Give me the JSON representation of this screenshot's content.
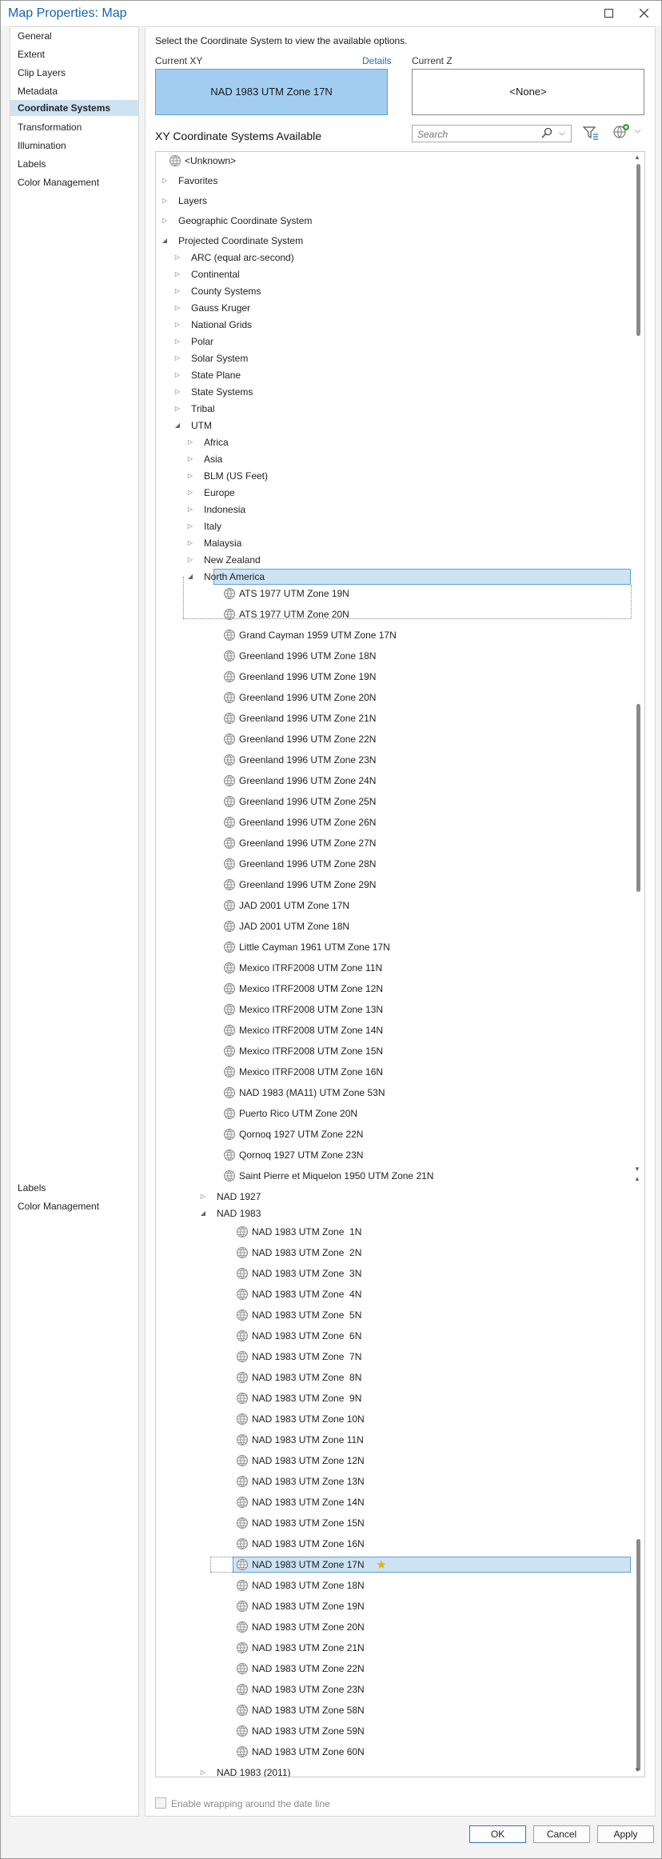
{
  "window": {
    "title": "Map Properties: Map"
  },
  "sidebar": {
    "items": [
      {
        "label": "General"
      },
      {
        "label": "Extent"
      },
      {
        "label": "Clip Layers"
      },
      {
        "label": "Metadata"
      },
      {
        "label": "Coordinate Systems",
        "selected": true
      },
      {
        "label": "Transformation"
      },
      {
        "label": "Illumination"
      },
      {
        "label": "Labels"
      },
      {
        "label": "Color Management"
      }
    ],
    "extra_items": [
      {
        "label": "Labels"
      },
      {
        "label": "Color Management"
      }
    ]
  },
  "panel": {
    "instruction": "Select the Coordinate System to view the available options.",
    "current_xy_label": "Current XY",
    "details_link": "Details",
    "current_xy_value": "NAD 1983 UTM Zone 17N",
    "current_z_label": "Current Z",
    "current_z_value": "<None>",
    "section_title": "XY Coordinate Systems Available",
    "search_placeholder": "Search",
    "wrap_label": "Enable wrapping around the date line"
  },
  "tree": {
    "rows": [
      {
        "label": "<Unknown>",
        "level": 0,
        "icon": "globe-icon"
      },
      {
        "label": "Favorites",
        "level": 0,
        "toggle": "collapsed"
      },
      {
        "label": "Layers",
        "level": 0,
        "toggle": "collapsed"
      },
      {
        "label": "Geographic Coordinate System",
        "level": 0,
        "toggle": "collapsed"
      },
      {
        "label": "Projected Coordinate System",
        "level": 0,
        "toggle": "expanded"
      },
      {
        "label": "ARC (equal arc-second)",
        "level": 1,
        "toggle": "collapsed"
      },
      {
        "label": "Continental",
        "level": 1,
        "toggle": "collapsed"
      },
      {
        "label": "County Systems",
        "level": 1,
        "toggle": "collapsed"
      },
      {
        "label": "Gauss Kruger",
        "level": 1,
        "toggle": "collapsed"
      },
      {
        "label": "National Grids",
        "level": 1,
        "toggle": "collapsed"
      },
      {
        "label": "Polar",
        "level": 1,
        "toggle": "collapsed"
      },
      {
        "label": "Solar System",
        "level": 1,
        "toggle": "collapsed"
      },
      {
        "label": "State Plane",
        "level": 1,
        "toggle": "collapsed"
      },
      {
        "label": "State Systems",
        "level": 1,
        "toggle": "collapsed"
      },
      {
        "label": "Tribal",
        "level": 1,
        "toggle": "collapsed"
      },
      {
        "label": "UTM",
        "level": 1,
        "toggle": "expanded"
      },
      {
        "label": "Africa",
        "level": 2,
        "toggle": "collapsed"
      },
      {
        "label": "Asia",
        "level": 2,
        "toggle": "collapsed"
      },
      {
        "label": "BLM (US Feet)",
        "level": 2,
        "toggle": "collapsed"
      },
      {
        "label": "Europe",
        "level": 2,
        "toggle": "collapsed"
      },
      {
        "label": "Indonesia",
        "level": 2,
        "toggle": "collapsed"
      },
      {
        "label": "Italy",
        "level": 2,
        "toggle": "collapsed"
      },
      {
        "label": "Malaysia",
        "level": 2,
        "toggle": "collapsed"
      },
      {
        "label": "New Zealand",
        "level": 2,
        "toggle": "collapsed"
      },
      {
        "label": "North America",
        "level": 2,
        "toggle": "expanded",
        "selected": true
      },
      {
        "label": "ATS 1977 UTM Zone 19N",
        "level": 3,
        "icon": "globe-icon"
      },
      {
        "label": "ATS 1977 UTM Zone 20N",
        "level": 3,
        "icon": "globe-icon"
      },
      {
        "label": "Grand Cayman 1959 UTM Zone 17N",
        "level": 3,
        "icon": "globe-icon"
      },
      {
        "label": "Greenland 1996 UTM Zone 18N",
        "level": 3,
        "icon": "globe-icon"
      },
      {
        "label": "Greenland 1996 UTM Zone 19N",
        "level": 3,
        "icon": "globe-icon"
      },
      {
        "label": "Greenland 1996 UTM Zone 20N",
        "level": 3,
        "icon": "globe-icon"
      },
      {
        "label": "Greenland 1996 UTM Zone 21N",
        "level": 3,
        "icon": "globe-icon"
      },
      {
        "label": "Greenland 1996 UTM Zone 22N",
        "level": 3,
        "icon": "globe-icon"
      },
      {
        "label": "Greenland 1996 UTM Zone 23N",
        "level": 3,
        "icon": "globe-icon"
      },
      {
        "label": "Greenland 1996 UTM Zone 24N",
        "level": 3,
        "icon": "globe-icon"
      },
      {
        "label": "Greenland 1996 UTM Zone 25N",
        "level": 3,
        "icon": "globe-icon"
      },
      {
        "label": "Greenland 1996 UTM Zone 26N",
        "level": 3,
        "icon": "globe-icon"
      },
      {
        "label": "Greenland 1996 UTM Zone 27N",
        "level": 3,
        "icon": "globe-icon"
      },
      {
        "label": "Greenland 1996 UTM Zone 28N",
        "level": 3,
        "icon": "globe-icon"
      },
      {
        "label": "Greenland 1996 UTM Zone 29N",
        "level": 3,
        "icon": "globe-icon"
      },
      {
        "label": "JAD 2001 UTM Zone 17N",
        "level": 3,
        "icon": "globe-icon"
      },
      {
        "label": "JAD 2001 UTM Zone 18N",
        "level": 3,
        "icon": "globe-icon"
      },
      {
        "label": "Little Cayman 1961 UTM Zone 17N",
        "level": 3,
        "icon": "globe-icon"
      },
      {
        "label": "Mexico ITRF2008 UTM Zone 11N",
        "level": 3,
        "icon": "globe-icon"
      },
      {
        "label": "Mexico ITRF2008 UTM Zone 12N",
        "level": 3,
        "icon": "globe-icon"
      },
      {
        "label": "Mexico ITRF2008 UTM Zone 13N",
        "level": 3,
        "icon": "globe-icon"
      },
      {
        "label": "Mexico ITRF2008 UTM Zone 14N",
        "level": 3,
        "icon": "globe-icon"
      },
      {
        "label": "Mexico ITRF2008 UTM Zone 15N",
        "level": 3,
        "icon": "globe-icon"
      },
      {
        "label": "Mexico ITRF2008 UTM Zone 16N",
        "level": 3,
        "icon": "globe-icon"
      },
      {
        "label": "NAD 1983 (MA11) UTM Zone 53N",
        "level": 3,
        "icon": "globe-icon"
      },
      {
        "label": "Puerto Rico UTM Zone 20N",
        "level": 3,
        "icon": "globe-icon"
      },
      {
        "label": "Qornoq 1927 UTM Zone 22N",
        "level": 3,
        "icon": "globe-icon"
      },
      {
        "label": "Qornoq 1927 UTM Zone 23N",
        "level": 3,
        "icon": "globe-icon"
      },
      {
        "label": "Saint Pierre et Miquelon 1950 UTM Zone 21N",
        "level": 3,
        "icon": "globe-icon"
      },
      {
        "label": "NAD 1927",
        "level": 3,
        "toggle": "collapsed"
      },
      {
        "label": "NAD 1983",
        "level": 3,
        "toggle": "expanded"
      },
      {
        "label": "NAD 1983 UTM Zone  1N",
        "level": 4,
        "icon": "globe-icon"
      },
      {
        "label": "NAD 1983 UTM Zone  2N",
        "level": 4,
        "icon": "globe-icon"
      },
      {
        "label": "NAD 1983 UTM Zone  3N",
        "level": 4,
        "icon": "globe-icon"
      },
      {
        "label": "NAD 1983 UTM Zone  4N",
        "level": 4,
        "icon": "globe-icon"
      },
      {
        "label": "NAD 1983 UTM Zone  5N",
        "level": 4,
        "icon": "globe-icon"
      },
      {
        "label": "NAD 1983 UTM Zone  6N",
        "level": 4,
        "icon": "globe-icon"
      },
      {
        "label": "NAD 1983 UTM Zone  7N",
        "level": 4,
        "icon": "globe-icon"
      },
      {
        "label": "NAD 1983 UTM Zone  8N",
        "level": 4,
        "icon": "globe-icon"
      },
      {
        "label": "NAD 1983 UTM Zone  9N",
        "level": 4,
        "icon": "globe-icon"
      },
      {
        "label": "NAD 1983 UTM Zone 10N",
        "level": 4,
        "icon": "globe-icon"
      },
      {
        "label": "NAD 1983 UTM Zone 11N",
        "level": 4,
        "icon": "globe-icon"
      },
      {
        "label": "NAD 1983 UTM Zone 12N",
        "level": 4,
        "icon": "globe-icon"
      },
      {
        "label": "NAD 1983 UTM Zone 13N",
        "level": 4,
        "icon": "globe-icon"
      },
      {
        "label": "NAD 1983 UTM Zone 14N",
        "level": 4,
        "icon": "globe-icon"
      },
      {
        "label": "NAD 1983 UTM Zone 15N",
        "level": 4,
        "icon": "globe-icon"
      },
      {
        "label": "NAD 1983 UTM Zone 16N",
        "level": 4,
        "icon": "globe-icon"
      },
      {
        "label": "NAD 1983 UTM Zone 17N",
        "level": 4,
        "icon": "globe-icon",
        "selected": true,
        "favorite": true
      },
      {
        "label": "NAD 1983 UTM Zone 18N",
        "level": 4,
        "icon": "globe-icon"
      },
      {
        "label": "NAD 1983 UTM Zone 19N",
        "level": 4,
        "icon": "globe-icon"
      },
      {
        "label": "NAD 1983 UTM Zone 20N",
        "level": 4,
        "icon": "globe-icon"
      },
      {
        "label": "NAD 1983 UTM Zone 21N",
        "level": 4,
        "icon": "globe-icon"
      },
      {
        "label": "NAD 1983 UTM Zone 22N",
        "level": 4,
        "icon": "globe-icon"
      },
      {
        "label": "NAD 1983 UTM Zone 23N",
        "level": 4,
        "icon": "globe-icon"
      },
      {
        "label": "NAD 1983 UTM Zone 58N",
        "level": 4,
        "icon": "globe-icon"
      },
      {
        "label": "NAD 1983 UTM Zone 59N",
        "level": 4,
        "icon": "globe-icon"
      },
      {
        "label": "NAD 1983 UTM Zone 60N",
        "level": 4,
        "icon": "globe-icon"
      },
      {
        "label": "NAD 1983 (2011)",
        "level": 3,
        "toggle": "collapsed"
      }
    ]
  },
  "buttons": {
    "ok": "OK",
    "cancel": "Cancel",
    "apply": "Apply"
  },
  "colors": {
    "accent": "#1464b4",
    "selection": "#cde3f4",
    "selection_border": "#5d9fd6",
    "current_xy_fill": "#a2cdf0"
  }
}
